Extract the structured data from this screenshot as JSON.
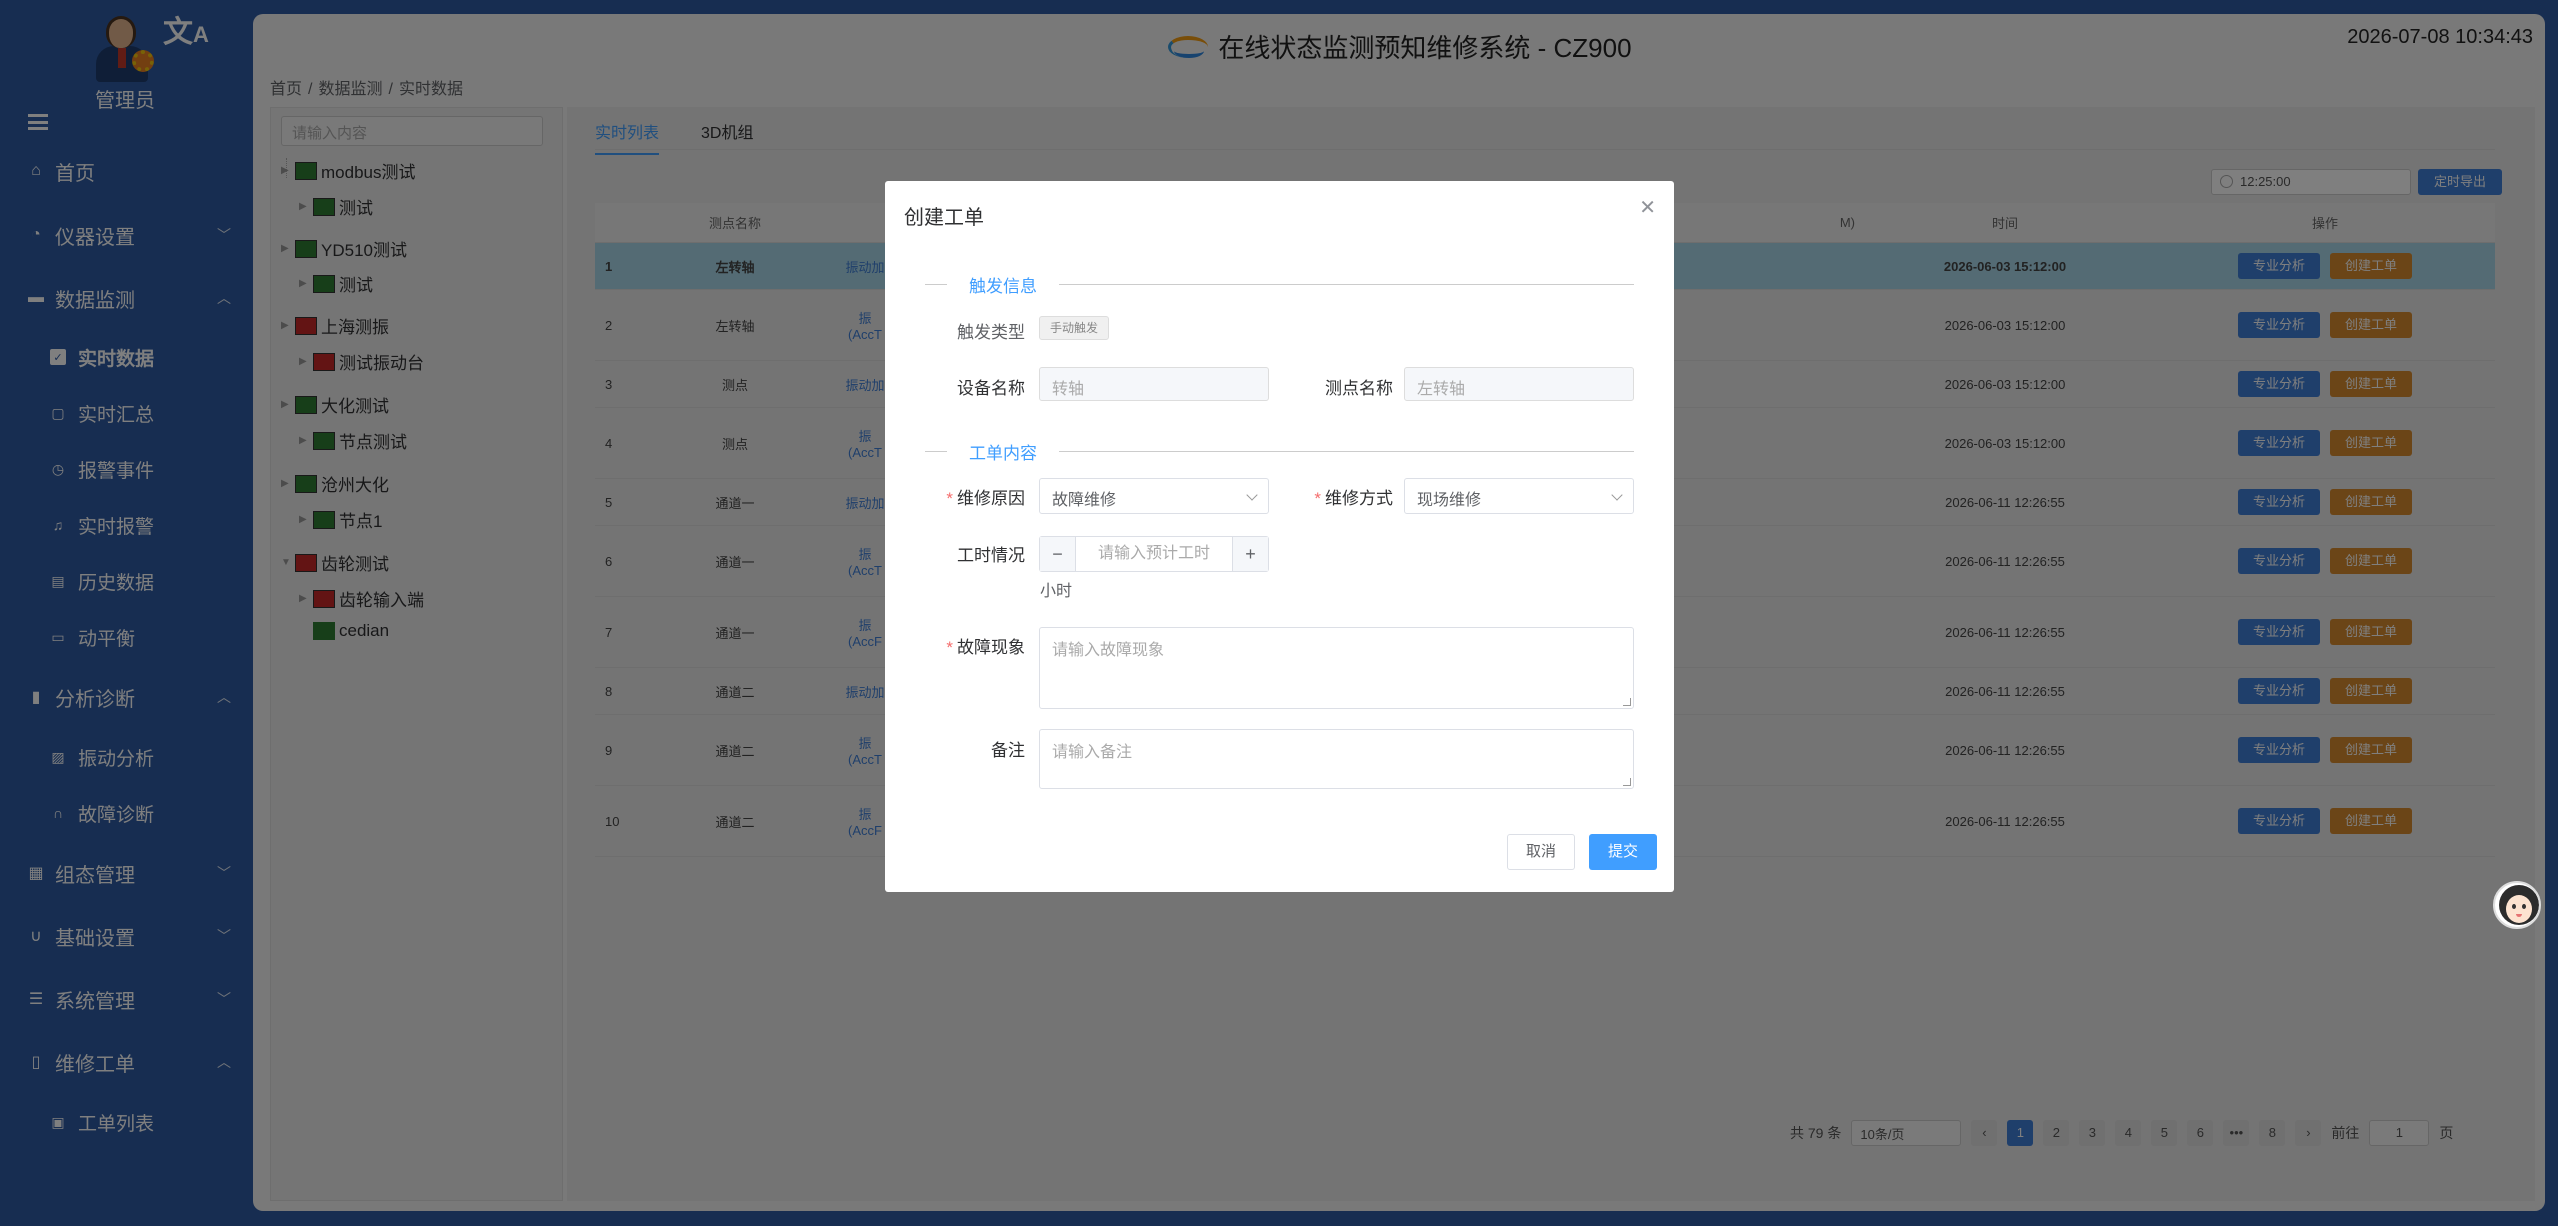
{
  "sidebar": {
    "user": "管理员",
    "items": [
      {
        "label": "首页",
        "icon": "home-icon"
      },
      {
        "label": "仪器设置",
        "icon": "gauge-icon"
      },
      {
        "label": "数据监测",
        "icon": "monitor-icon"
      },
      {
        "label": "实时数据",
        "icon": "chart-box-icon"
      },
      {
        "label": "实时汇总",
        "icon": "clipboard-icon"
      },
      {
        "label": "报警事件",
        "icon": "alarm-icon"
      },
      {
        "label": "实时报警",
        "icon": "bell-icon"
      },
      {
        "label": "历史数据",
        "icon": "history-icon"
      },
      {
        "label": "动平衡",
        "icon": "balance-icon"
      },
      {
        "label": "分析诊断",
        "icon": "bar-chart-icon"
      },
      {
        "label": "振动分析",
        "icon": "wave-chart-icon"
      },
      {
        "label": "故障诊断",
        "icon": "headset-icon"
      },
      {
        "label": "组态管理",
        "icon": "grid-icon"
      },
      {
        "label": "基础设置",
        "icon": "magnet-icon"
      },
      {
        "label": "系统管理",
        "icon": "sliders-icon"
      },
      {
        "label": "维修工单",
        "icon": "document-icon"
      },
      {
        "label": "工单列表",
        "icon": "list-icon"
      }
    ]
  },
  "header": {
    "title": "在线状态监测预知维修系统 - CZ900",
    "datetime": "2026-07-08 10:34:43",
    "breadcrumb": [
      "首页",
      "/",
      "数据监测",
      "/",
      "实时数据"
    ]
  },
  "tree": {
    "search_placeholder": "请输入内容",
    "nodes": [
      "modbus测试",
      "测试",
      "YD510测试",
      "测试",
      "上海测振",
      "测试振动台",
      "大化测试",
      "节点测试",
      "沧州大化",
      "节点1",
      "齿轮测试",
      "齿轮输入端",
      "cedian"
    ]
  },
  "tabs": [
    "实时列表",
    "3D机组"
  ],
  "toolbar": {
    "time": "12:25:00",
    "export": "定时导出"
  },
  "table": {
    "headers": [
      "测点名称",
      "时间",
      "操作",
      "M)"
    ],
    "btn_analysis": "专业分析",
    "btn_ticket": "创建工单",
    "rows": [
      {
        "idx": "1",
        "name": "左转轴",
        "ch": "振动加",
        "ch2": "",
        "time": "2026-06-03 15:12:00"
      },
      {
        "idx": "2",
        "name": "左转轴",
        "ch": "振",
        "ch2": "(AccT",
        "time": "2026-06-03 15:12:00"
      },
      {
        "idx": "3",
        "name": "测点",
        "ch": "振动加",
        "ch2": "",
        "time": "2026-06-03 15:12:00"
      },
      {
        "idx": "4",
        "name": "测点",
        "ch": "振",
        "ch2": "(AccT",
        "time": "2026-06-03 15:12:00"
      },
      {
        "idx": "5",
        "name": "通道一",
        "ch": "振动加",
        "ch2": "",
        "time": "2026-06-11 12:26:55"
      },
      {
        "idx": "6",
        "name": "通道一",
        "ch": "振",
        "ch2": "(AccT",
        "time": "2026-06-11 12:26:55"
      },
      {
        "idx": "7",
        "name": "通道一",
        "ch": "振",
        "ch2": "(AccF",
        "time": "2026-06-11 12:26:55"
      },
      {
        "idx": "8",
        "name": "通道二",
        "ch": "振动加",
        "ch2": "",
        "time": "2026-06-11 12:26:55"
      },
      {
        "idx": "9",
        "name": "通道二",
        "ch": "振",
        "ch2": "(AccT",
        "time": "2026-06-11 12:26:55"
      },
      {
        "idx": "10",
        "name": "通道二",
        "ch": "振",
        "ch2": "(AccF",
        "time": "2026-06-11 12:26:55"
      }
    ]
  },
  "pagination": {
    "total": "共 79 条",
    "page_size": "10条/页",
    "pages": [
      "1",
      "2",
      "3",
      "4",
      "5",
      "6",
      "•••",
      "8"
    ],
    "goto_label": "前往",
    "goto_value": "1",
    "goto_suffix": "页"
  },
  "modal": {
    "title": "创建工单",
    "section1": "触发信息",
    "trigger_label": "触发类型",
    "trigger_value": "手动触发",
    "device_label": "设备名称",
    "device_value": "转轴",
    "point_label": "测点名称",
    "point_value": "左转轴",
    "section2": "工单内容",
    "reason_label": "维修原因",
    "reason_value": "故障维修",
    "method_label": "维修方式",
    "method_value": "现场维修",
    "hours_label": "工时情况",
    "hours_placeholder": "请输入预计工时",
    "hours_unit": "小时",
    "phenomenon_label": "故障现象",
    "phenomenon_placeholder": "请输入故障现象",
    "remark_label": "备注",
    "remark_placeholder": "请输入备注",
    "cancel": "取消",
    "submit": "提交"
  },
  "colors": {
    "sidebar_bg": "#2e5ba3",
    "accent": "#409eff",
    "button_blue": "#3f7ed6",
    "button_orange": "#d68a2e",
    "row_highlight": "#a8d7e8"
  }
}
